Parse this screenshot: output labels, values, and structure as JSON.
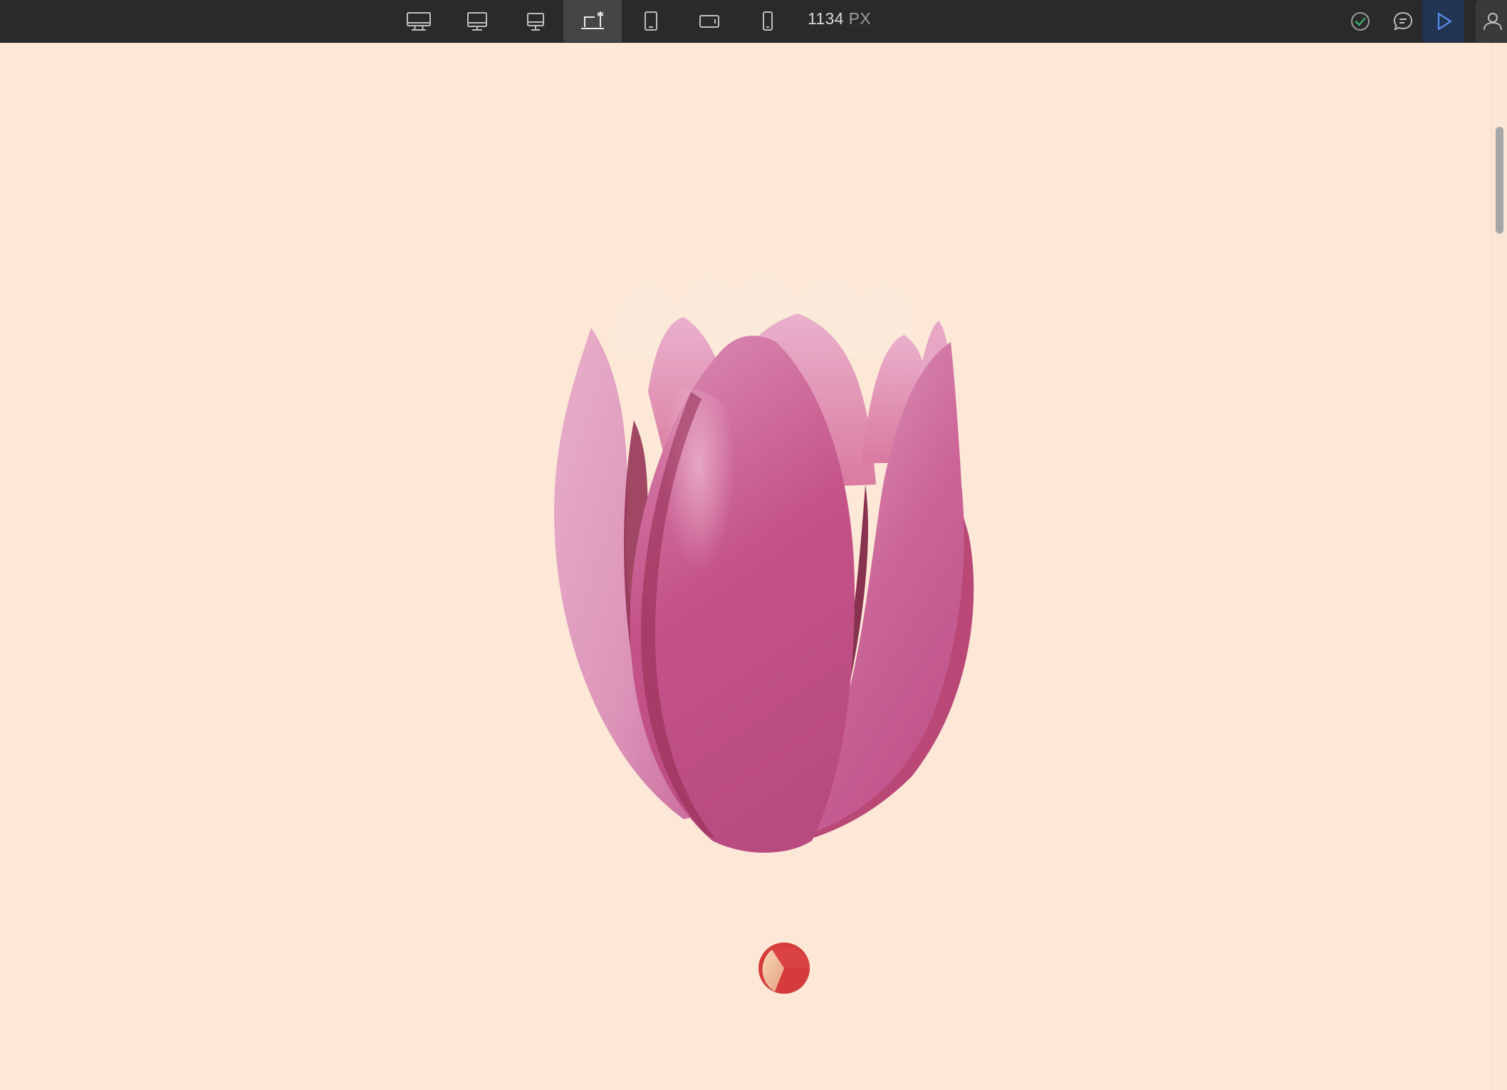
{
  "toolbar": {
    "breakpoints": [
      {
        "name": "desktop-xl",
        "icon": "monitor-wide-icon",
        "active": false
      },
      {
        "name": "desktop",
        "icon": "monitor-icon",
        "active": false
      },
      {
        "name": "desktop-sm",
        "icon": "monitor-small-icon",
        "active": false
      },
      {
        "name": "laptop",
        "icon": "laptop-star-icon",
        "active": true
      },
      {
        "name": "tablet",
        "icon": "tablet-icon",
        "active": false
      },
      {
        "name": "tablet-landscape",
        "icon": "tablet-landscape-icon",
        "active": false
      },
      {
        "name": "mobile",
        "icon": "phone-icon",
        "active": false
      }
    ],
    "width_value": "1134",
    "width_unit": "PX",
    "status_icon": "check-circle-icon",
    "comment_icon": "comment-icon",
    "preview_icon": "play-icon",
    "account_icon": "user-icon"
  },
  "colors": {
    "toolbar_bg": "#2a2a2a",
    "canvas_bg": "#fde8d8",
    "active_breakpoint_bg": "#444446",
    "preview_accent": "#5b8def",
    "status_ok": "#3bb36b",
    "petal_main": "#c45388",
    "petal_light": "#e3a6c4",
    "spinner_red": "#d63b3b",
    "spinner_light": "#f3c9a8"
  },
  "canvas": {
    "illustration": "tulip",
    "loader": "loading-spinner"
  }
}
